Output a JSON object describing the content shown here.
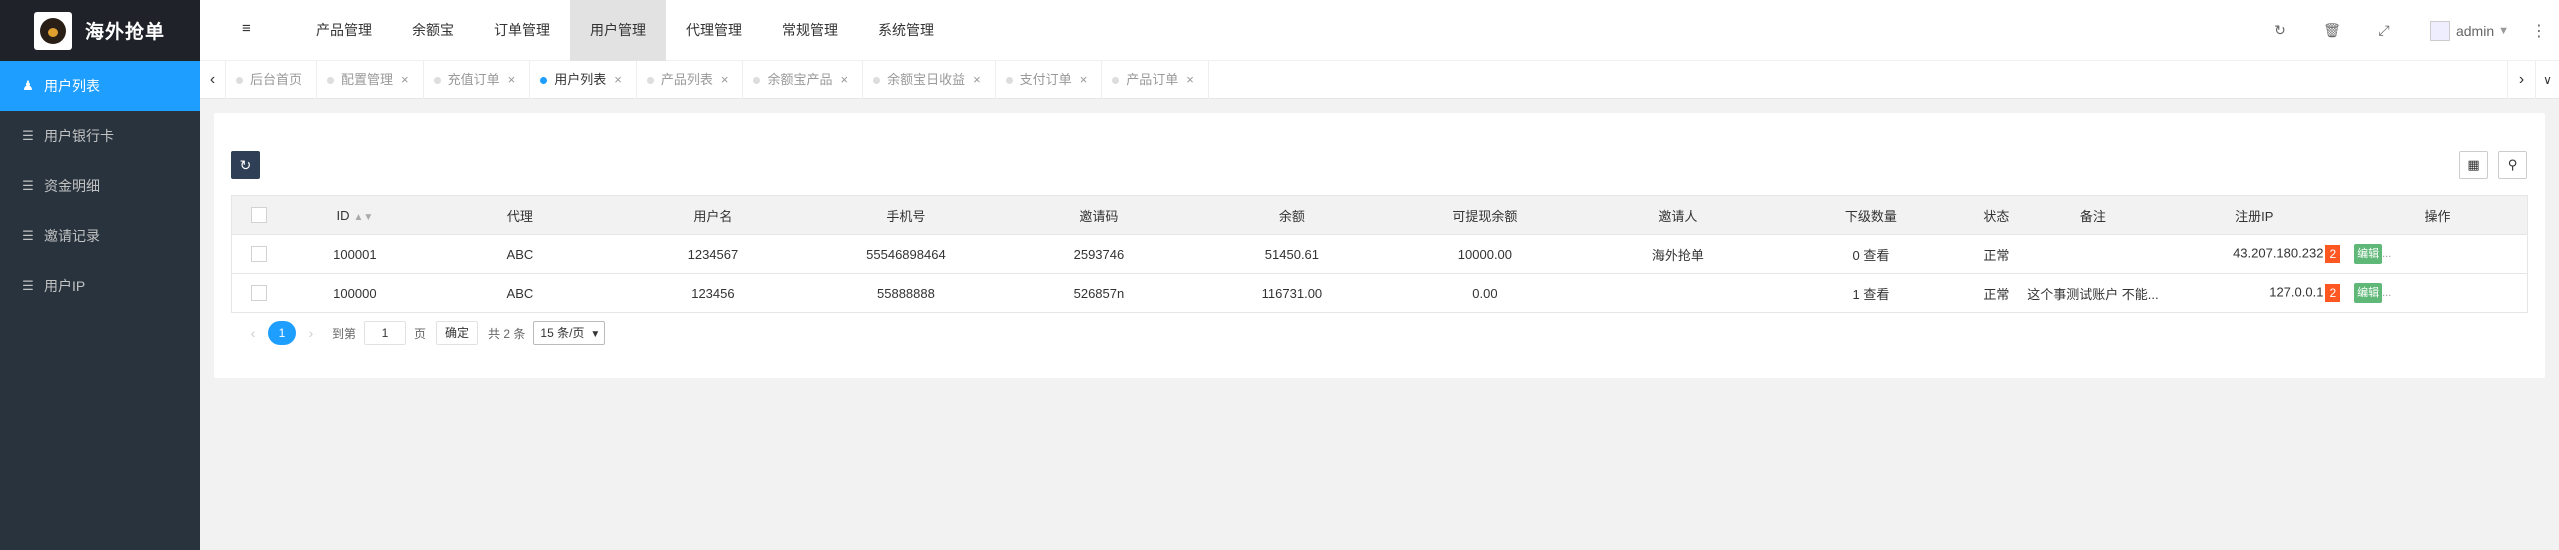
{
  "app": {
    "title": "海外抢单"
  },
  "sidebar": {
    "items": [
      {
        "label": "用户列表",
        "icon": "users-icon",
        "active": true
      },
      {
        "label": "用户银行卡",
        "icon": "list-icon"
      },
      {
        "label": "资金明细",
        "icon": "list-icon"
      },
      {
        "label": "邀请记录",
        "icon": "list-icon"
      },
      {
        "label": "用户IP",
        "icon": "list-icon"
      }
    ]
  },
  "header": {
    "nav": [
      "产品管理",
      "余额宝",
      "订单管理",
      "用户管理",
      "代理管理",
      "常规管理",
      "系统管理"
    ],
    "active_nav": "用户管理",
    "user": "admin",
    "accent": "#1e9fff"
  },
  "tabs": [
    {
      "label": "后台首页"
    },
    {
      "label": "配置管理"
    },
    {
      "label": "充值订单"
    },
    {
      "label": "用户列表",
      "active": true
    },
    {
      "label": "产品列表"
    },
    {
      "label": "余额宝产品"
    },
    {
      "label": "余额宝日收益"
    },
    {
      "label": "支付订单"
    },
    {
      "label": "产品订单"
    }
  ],
  "table": {
    "columns": [
      "ID",
      "代理",
      "用户名",
      "手机号",
      "邀请码",
      "余额",
      "可提现余额",
      "邀请人",
      "下级数量",
      "状态",
      "备注",
      "注册IP",
      "操作"
    ],
    "rows": [
      {
        "id": "100001",
        "agent": "ABC",
        "username": "1234567",
        "phone": "55546898464",
        "invite_code": "2593746",
        "balance": "51450.61",
        "withdrawable": "10000.00",
        "inviter": "海外抢单",
        "sub_count": "0",
        "sub_view": "查看",
        "status": "正常",
        "remark": "",
        "ip": "43.207.180.232",
        "ip_count": "2",
        "edit": "编辑",
        "more": "..."
      },
      {
        "id": "100000",
        "agent": "ABC",
        "username": "123456",
        "phone": "55888888",
        "invite_code": "526857n",
        "balance": "116731.00",
        "withdrawable": "0.00",
        "inviter": "",
        "sub_count": "1",
        "sub_view": "查看",
        "status": "正常",
        "remark": "这个事测试账户 不能...",
        "ip": "127.0.0.1",
        "ip_count": "2",
        "edit": "编辑",
        "more": "..."
      }
    ]
  },
  "pager": {
    "current": "1",
    "goto_prefix": "到第",
    "goto_value": "1",
    "goto_suffix": "页",
    "confirm": "确定",
    "total": "共 2 条",
    "page_size": "15 条/页"
  }
}
